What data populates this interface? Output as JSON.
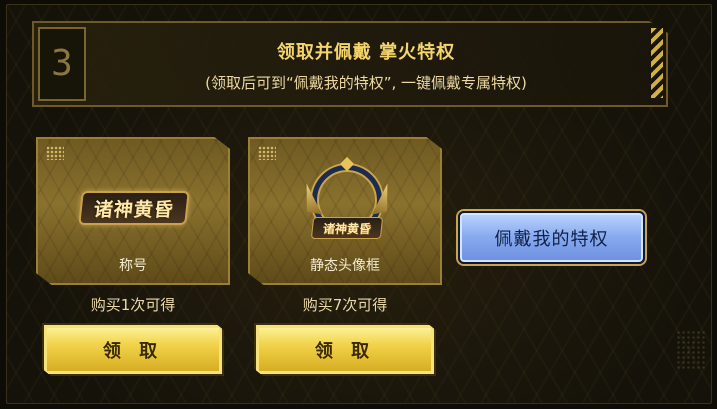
{
  "header": {
    "step_number": "3",
    "title": "领取并佩戴 掌火特权",
    "subtitle": "(领取后可到“佩戴我的特权”, 一键佩戴专属特权)"
  },
  "rewards": [
    {
      "logo_text": "诸神黄昏",
      "label": "称号",
      "requirement": "购买1次可得",
      "button_label": "领 取"
    },
    {
      "logo_text": "诸神黄昏",
      "label": "静态头像框",
      "requirement": "购买7次可得",
      "button_label": "领 取"
    }
  ],
  "wear_button": {
    "label": "佩戴我的特权"
  },
  "colors": {
    "accent_gold": "#f3d56c",
    "claim_button": "#f1d34a",
    "wear_button": "#86a9ee",
    "panel_bg": "#15120a"
  }
}
